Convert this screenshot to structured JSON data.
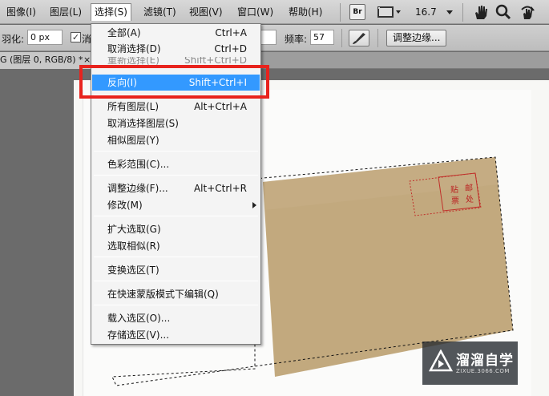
{
  "menubar": {
    "items": [
      "图像(I)",
      "图层(L)",
      "选择(S)",
      "滤镜(T)",
      "视图(V)",
      "窗口(W)",
      "帮助(H)"
    ],
    "br_label": "Br",
    "zoom": "16.7"
  },
  "options": {
    "feather_label": "羽化:",
    "feather_value": "0 px",
    "antialias_partial": "消",
    "frequency_label": "频率:",
    "frequency_value": "57",
    "refine_button": "调整边缘..."
  },
  "doc_tab": {
    "title": "G (图层 0, RGB/8) *",
    "close": "×"
  },
  "select_menu": {
    "items": [
      {
        "label": "全部(A)",
        "shortcut": "Ctrl+A"
      },
      {
        "label": "取消选择(D)",
        "shortcut": "Ctrl+D"
      },
      {
        "label": "重新选择(E)",
        "shortcut": "Shift+Ctrl+D"
      },
      {
        "label": "反向(I)",
        "shortcut": "Shift+Ctrl+I"
      },
      {
        "label": "所有图层(L)",
        "shortcut": "Alt+Ctrl+A"
      },
      {
        "label": "取消选择图层(S)",
        "shortcut": ""
      },
      {
        "label": "相似图层(Y)",
        "shortcut": ""
      },
      {
        "label": "色彩范围(C)...",
        "shortcut": ""
      },
      {
        "label": "调整边缘(F)...",
        "shortcut": "Alt+Ctrl+R"
      },
      {
        "label": "修改(M)",
        "shortcut": ""
      },
      {
        "label": "扩大选取(G)",
        "shortcut": ""
      },
      {
        "label": "选取相似(R)",
        "shortcut": ""
      },
      {
        "label": "变换选区(T)",
        "shortcut": ""
      },
      {
        "label": "在快速蒙版模式下编辑(Q)",
        "shortcut": ""
      },
      {
        "label": "载入选区(O)...",
        "shortcut": ""
      },
      {
        "label": "存储选区(V)...",
        "shortcut": ""
      }
    ]
  },
  "envelope": {
    "stamp_text_1": "贴",
    "stamp_text_2": "邮",
    "stamp_text_3": "票",
    "stamp_text_4": "处"
  },
  "watermark": {
    "title": "溜溜自学",
    "subtitle": "ZIXUE.3066.COM"
  },
  "colors": {
    "highlight": "#3399ff",
    "annotation_box": "#e8231d",
    "envelope": "#c2a97e"
  },
  "icons": [
    "hand-icon",
    "zoom-icon",
    "rotate-view-icon",
    "brush-icon",
    "film-icon",
    "dropdown-arrow-icon"
  ]
}
